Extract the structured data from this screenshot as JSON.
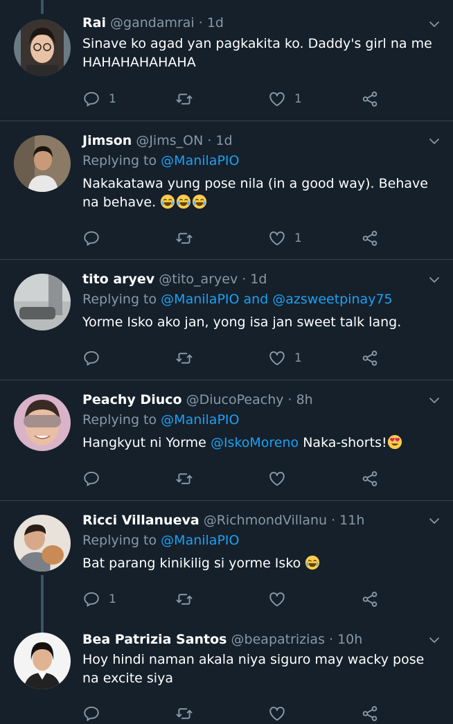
{
  "tweets": [
    {
      "name": "Rai",
      "handle": "@gandamrai · 1d",
      "text": "Sinave ko agad yan pagkakita ko. Daddy's girl na me HAHAHAHAHAHA",
      "reply_count": "1",
      "like_count": "1"
    },
    {
      "name": "Jimson",
      "handle": "@Jims_ON · 1d",
      "replying_to": "Replying to",
      "mention": "@ManilaPIO",
      "text": "Nakakatawa yung pose nila (in a good way). Behave na behave.",
      "like_count": "1"
    },
    {
      "name": "tito aryev",
      "handle": "@tito_aryev · 1d",
      "replying_to": "Replying to",
      "mention": "@ManilaPIO and @azsweetpinay75",
      "text": "Yorme Isko ako jan, yong isa jan sweet talk lang.",
      "like_count": "1"
    },
    {
      "name": "Peachy Diuco",
      "handle": "@DiucoPeachy · 8h",
      "replying_to": "Replying to",
      "mention": "@ManilaPIO",
      "text_before": "Hangkyut ni Yorme",
      "text_mention": "@IskoMoreno",
      "text_after": "Naka-shorts!"
    },
    {
      "name": "Ricci Villanueva",
      "handle": "@RichmondVillanu · 11h",
      "replying_to": "Replying to",
      "mention": "@ManilaPIO",
      "text": "Bat parang kinikilig si yorme Isko",
      "reply_count": "1"
    },
    {
      "name": "Bea Patrizia Santos",
      "handle": "@beapatrizias · 10h",
      "text": "Hoy hindi naman akala niya siguro may wacky pose na excite siya"
    }
  ],
  "icons": {
    "reply": "reply-icon",
    "retweet": "retweet-icon",
    "like": "heart-icon",
    "share": "share-icon",
    "more": "chevron-down-icon"
  },
  "colors": {
    "background": "#15202b",
    "divider": "#38444d",
    "secondary_text": "#8899a6",
    "link": "#1da1f2"
  }
}
